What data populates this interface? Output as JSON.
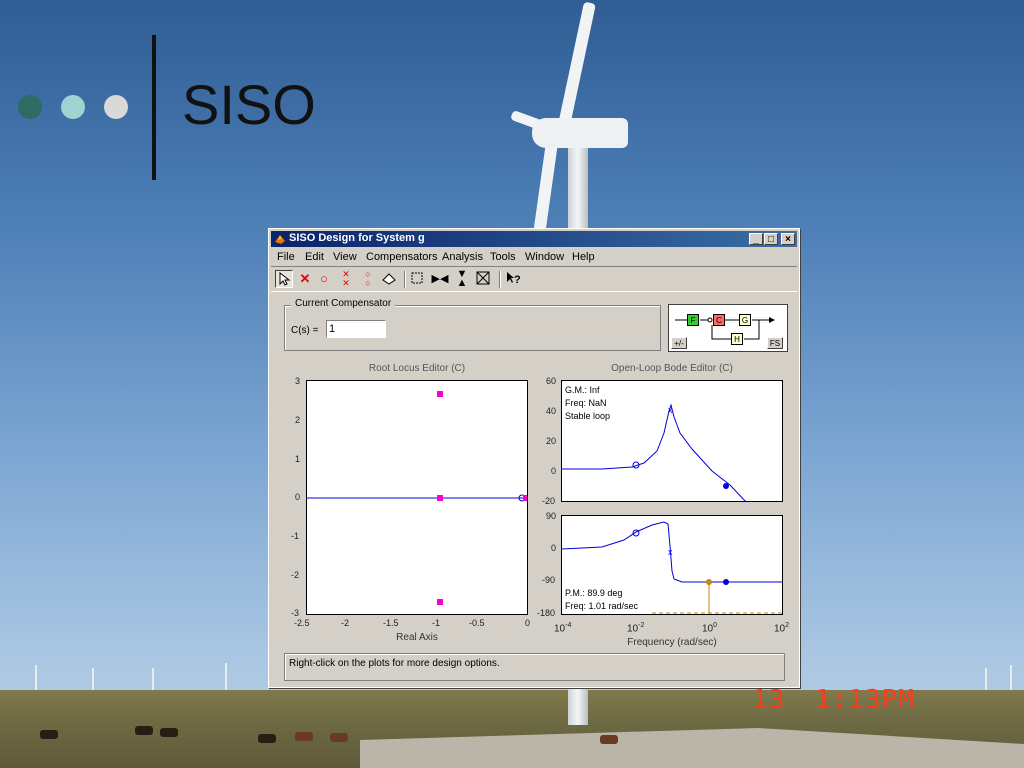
{
  "slide": {
    "title": "SISO",
    "dot_colors": [
      "#2e6b62",
      "#9fd3d1",
      "#d9d9d9"
    ],
    "date_stamp": "13",
    "time_stamp": "1:13PM"
  },
  "window": {
    "title": "SISO Design for System g",
    "controls": {
      "minimize": "_",
      "maximize": "□",
      "close": "×"
    },
    "menu": [
      "File",
      "Edit",
      "View",
      "Compensators",
      "Analysis",
      "Tools",
      "Window",
      "Help"
    ],
    "toolbar_icons": [
      "select-arrow-icon",
      "add-pole-icon",
      "add-zero-icon",
      "add-complex-pole-icon",
      "add-complex-zero-icon",
      "eraser-icon",
      "zoom-xy-icon",
      "zoom-x-icon",
      "zoom-y-icon",
      "fit-icon",
      "whats-this-icon"
    ],
    "compensator": {
      "legend": "Current Compensator",
      "label": "C(s) =",
      "value": "1"
    },
    "diagram": {
      "blocks": {
        "f": "F",
        "c": "C",
        "g": "G",
        "h": "H"
      },
      "sign_button": "+/-",
      "fs_button": "FS"
    },
    "status_text": "Right-click on the plots for more design options."
  },
  "root_locus": {
    "title": "Root Locus Editor (C)",
    "xlabel": "Real Axis",
    "xticks": [
      "-2.5",
      "-2",
      "-1.5",
      "-1",
      "-0.5",
      "0"
    ],
    "yticks": [
      "3",
      "2",
      "1",
      "0",
      "-1",
      "-2",
      "-3"
    ]
  },
  "bode": {
    "title": "Open-Loop Bode Editor (C)",
    "xlabel": "Frequency (rad/sec)",
    "mag_yticks": [
      "60",
      "40",
      "20",
      "0",
      "-20"
    ],
    "phase_yticks": [
      "90",
      "0",
      "-90",
      "-180"
    ],
    "xticks": [
      {
        "base": "10",
        "exp": "-4"
      },
      {
        "base": "10",
        "exp": "-2"
      },
      {
        "base": "10",
        "exp": "0"
      },
      {
        "base": "10",
        "exp": "2"
      }
    ],
    "gm": "G.M.: Inf",
    "gm_freq": "Freq: NaN",
    "stability": "Stable loop",
    "pm": "P.M.: 89.9 deg",
    "pm_freq": "Freq: 1.01 rad/sec"
  },
  "colors": {
    "curve": "#0000dd",
    "pole_marker": "#ff00cc",
    "margin_marker": "#c8860a",
    "block_f": "#33cc33",
    "block_c": "#ff6666",
    "block_g": "#ffffcc",
    "block_h": "#ffffcc"
  }
}
